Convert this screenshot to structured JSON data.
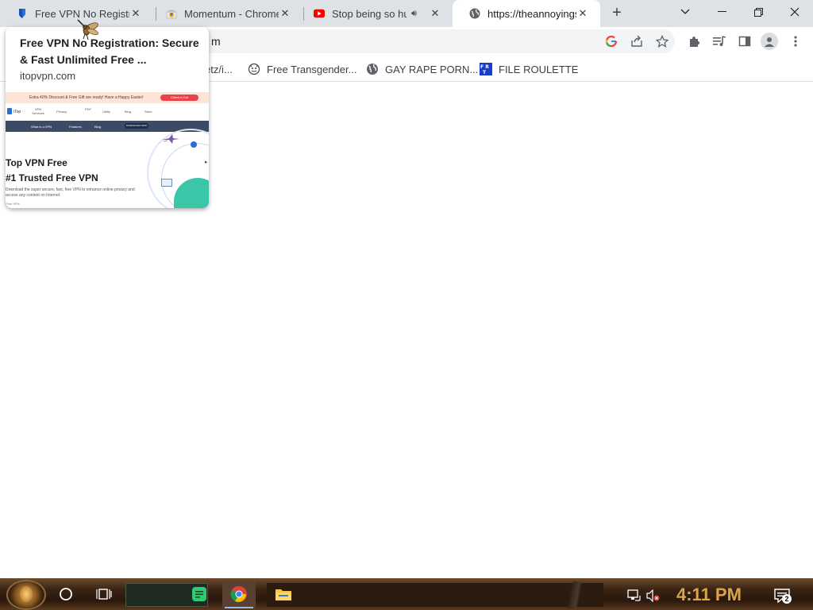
{
  "tabs": [
    {
      "title": "Free VPN No Registration",
      "favicon": "itopvpn-shield-icon",
      "active": false
    },
    {
      "title": "Momentum - Chrome Web Store",
      "favicon": "chrome-webstore-icon",
      "active": false
    },
    {
      "title": "Stop being so hungry",
      "favicon": "youtube-icon",
      "active": false,
      "audio": "speaker-icon"
    },
    {
      "title": "https://theannoyingsite.com",
      "favicon": "globe-icon",
      "active": true
    }
  ],
  "omnibox": {
    "visible_text": "m"
  },
  "bookmarks": [
    {
      "label": "etz/i...",
      "icon": "bookmark-page-icon"
    },
    {
      "label": "Free Transgender...",
      "icon": "web-icon"
    },
    {
      "label": "GAY RAPE PORN...",
      "icon": "globe-icon"
    },
    {
      "label": "FILE ROULETTE",
      "icon": "file-roulette-icon"
    }
  ],
  "hover_card": {
    "title": "Free VPN No Registration: Secure & Fast Unlimited Free ...",
    "domain": "itopvpn.com",
    "preview": {
      "banner_text": "Extra 40% Discount & Free Gift are ready! Have a Happy Easter!",
      "banner_button": "Check it Out",
      "logo_text": "iTop",
      "nav_items": [
        "VPN Services",
        "Privacy",
        "PDF",
        "Utility",
        "Blog",
        "Store"
      ],
      "bar_items": [
        "What is a VPN",
        "Features",
        "Blog"
      ],
      "bar_button": "DOWNLOAD NOW",
      "hero_line1": "Top VPN Free",
      "hero_line2": "#1 Trusted Free VPN",
      "hero_sub": "Download the super secure, fast, free VPN to enhance online privacy and access any content on Internet.",
      "hero_foot": "Free VPN"
    }
  },
  "taskbar": {
    "clock": "4:11 PM",
    "notification_count": "2"
  }
}
